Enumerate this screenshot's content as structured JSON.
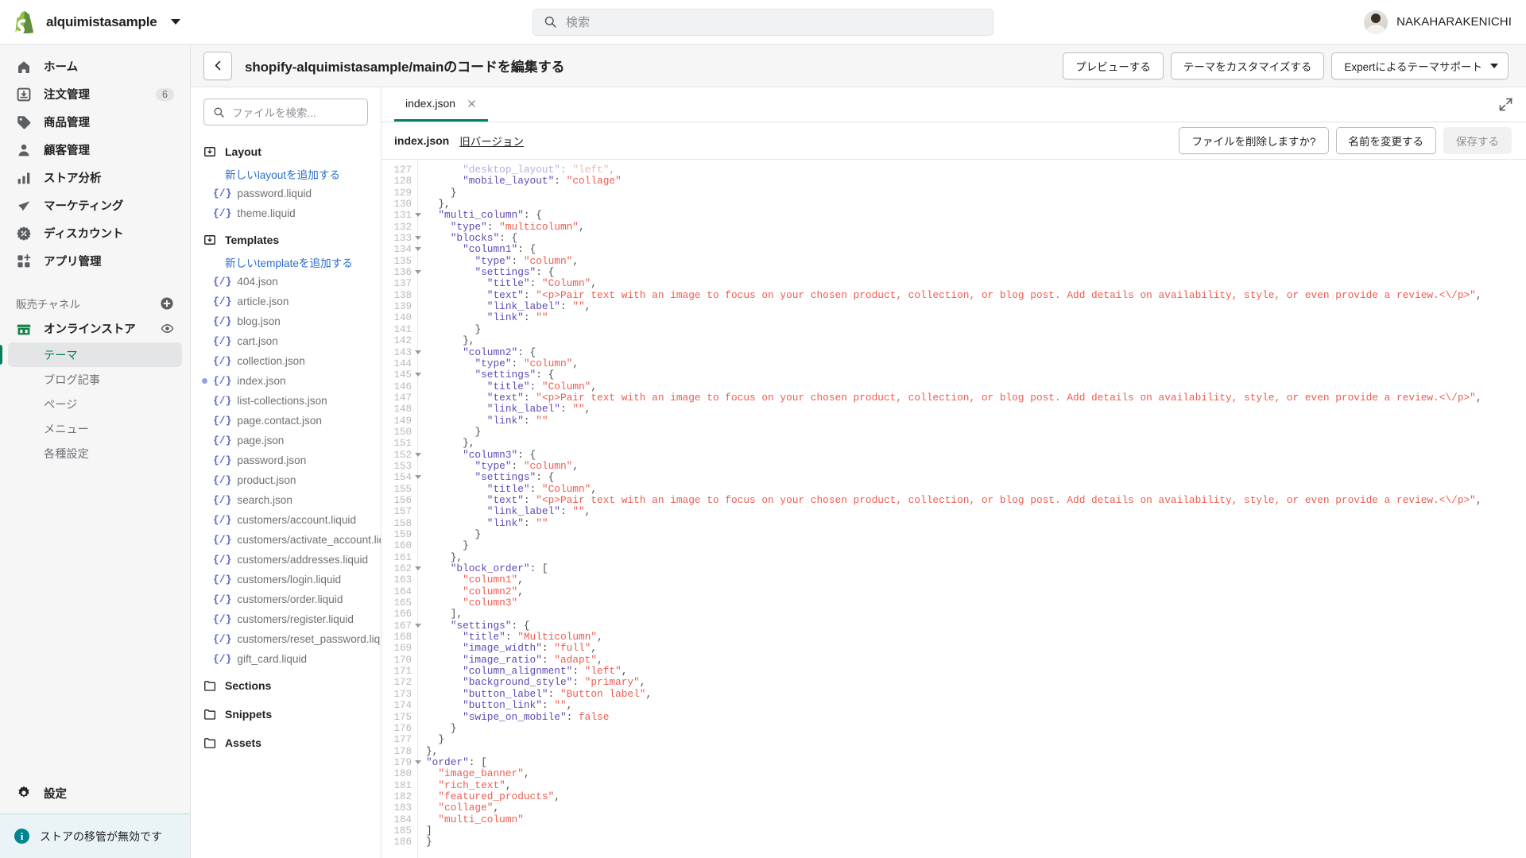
{
  "topbar": {
    "store_name": "alquimistasample",
    "store_caret_icon": "chevron-down-icon",
    "search_icon": "search-icon",
    "search_placeholder": "検索",
    "search_value": "",
    "user_name": "NAKAHARAKENICHI",
    "logo_icon": "shopify-bag-icon"
  },
  "sidebar": {
    "items": [
      {
        "label": "ホーム",
        "icon": "home-icon",
        "badge": ""
      },
      {
        "label": "注文管理",
        "icon": "orders-inbox-icon",
        "badge": "6"
      },
      {
        "label": "商品管理",
        "icon": "product-tag-icon",
        "badge": ""
      },
      {
        "label": "顧客管理",
        "icon": "customer-person-icon",
        "badge": ""
      },
      {
        "label": "ストア分析",
        "icon": "analytics-bars-icon",
        "badge": ""
      },
      {
        "label": "マーケティング",
        "icon": "marketing-megaphone-icon",
        "badge": ""
      },
      {
        "label": "ディスカウント",
        "icon": "discount-percent-icon",
        "badge": ""
      },
      {
        "label": "アプリ管理",
        "icon": "apps-grid-plus-icon",
        "badge": ""
      }
    ],
    "channels_header": "販売チャネル",
    "channels_add_icon": "plus-circle-icon",
    "online_store": {
      "label": "オンラインストア",
      "icon": "storefront-icon",
      "view_icon": "eye-icon"
    },
    "online_store_children": [
      {
        "label": "テーマ",
        "active": true
      },
      {
        "label": "ブログ記事",
        "active": false
      },
      {
        "label": "ページ",
        "active": false
      },
      {
        "label": "メニュー",
        "active": false
      },
      {
        "label": "各種設定",
        "active": false
      }
    ],
    "settings": {
      "label": "設定",
      "icon": "gear-icon"
    },
    "notice": {
      "icon": "info-icon",
      "text": "ストアの移管が無効です"
    }
  },
  "editor_header": {
    "back_icon": "arrow-left-icon",
    "title": "shopify-alquimistasample/mainのコードを編集する",
    "buttons": [
      {
        "label": "プレビューする",
        "name": "preview-button",
        "caret": false
      },
      {
        "label": "テーマをカスタマイズする",
        "name": "customize-theme-button",
        "caret": false
      },
      {
        "label": "Expertによるテーマサポート",
        "name": "expert-theme-support-button",
        "caret": true
      }
    ],
    "caret_icon": "chevron-down-icon"
  },
  "filetree": {
    "search_icon": "search-icon",
    "search_placeholder": "ファイルを検索...",
    "search_value": "",
    "groups": [
      {
        "name": "Layout",
        "icon": "folder-download-icon",
        "add_link": "新しいlayoutを追加する",
        "files": [
          {
            "name": "password.liquid",
            "modified": false
          },
          {
            "name": "theme.liquid",
            "modified": false
          }
        ]
      },
      {
        "name": "Templates",
        "icon": "folder-download-icon",
        "add_link": "新しいtemplateを追加する",
        "files": [
          {
            "name": "404.json",
            "modified": false
          },
          {
            "name": "article.json",
            "modified": false
          },
          {
            "name": "blog.json",
            "modified": false
          },
          {
            "name": "cart.json",
            "modified": false
          },
          {
            "name": "collection.json",
            "modified": false
          },
          {
            "name": "index.json",
            "modified": true
          },
          {
            "name": "list-collections.json",
            "modified": false
          },
          {
            "name": "page.contact.json",
            "modified": false
          },
          {
            "name": "page.json",
            "modified": false
          },
          {
            "name": "password.json",
            "modified": false
          },
          {
            "name": "product.json",
            "modified": false
          },
          {
            "name": "search.json",
            "modified": false
          },
          {
            "name": "customers/account.liquid",
            "modified": false
          },
          {
            "name": "customers/activate_account.liquid",
            "modified": false
          },
          {
            "name": "customers/addresses.liquid",
            "modified": false
          },
          {
            "name": "customers/login.liquid",
            "modified": false
          },
          {
            "name": "customers/order.liquid",
            "modified": false
          },
          {
            "name": "customers/register.liquid",
            "modified": false
          },
          {
            "name": "customers/reset_password.liquid",
            "modified": false
          },
          {
            "name": "gift_card.liquid",
            "modified": false
          }
        ]
      }
    ],
    "collapsed_folders": [
      {
        "name": "Sections",
        "icon": "folder-icon"
      },
      {
        "name": "Snippets",
        "icon": "folder-icon"
      },
      {
        "name": "Assets",
        "icon": "folder-icon"
      }
    ]
  },
  "codepane": {
    "tab": {
      "label": "index.json",
      "close_icon": "close-icon"
    },
    "expand_icon": "expand-fullscreen-icon",
    "file_name": "index.json",
    "old_version_link": "旧バージョン",
    "actions": [
      {
        "label": "ファイルを削除しますか?",
        "name": "delete-file-button",
        "disabled": false
      },
      {
        "label": "名前を変更する",
        "name": "rename-file-button",
        "disabled": false
      },
      {
        "label": "保存する",
        "name": "save-button",
        "disabled": true
      }
    ],
    "first_line": 127,
    "last_line": 186,
    "fold_lines": [
      131,
      133,
      134,
      136,
      143,
      145,
      152,
      154,
      162,
      167,
      179
    ],
    "lines": [
      {
        "n": 127,
        "html": "<span class=\"trunc-top\">      <span class=\"k\">\"desktop_layout\"</span><span class=\"p\">: </span><span class=\"s\">\"left\"</span><span class=\"p\">,</span></span>"
      },
      {
        "n": 128,
        "html": "      <span class=\"k\">\"mobile_layout\"</span><span class=\"p\">: </span><span class=\"s\">\"collage\"</span>"
      },
      {
        "n": 129,
        "html": "    <span class=\"p\">}</span>"
      },
      {
        "n": 130,
        "html": "  <span class=\"p\">},</span>"
      },
      {
        "n": 131,
        "html": "  <span class=\"k\">\"multi_column\"</span><span class=\"p\">: {</span>"
      },
      {
        "n": 132,
        "html": "    <span class=\"k\">\"type\"</span><span class=\"p\">: </span><span class=\"s\">\"multicolumn\"</span><span class=\"p\">,</span>"
      },
      {
        "n": 133,
        "html": "    <span class=\"k\">\"blocks\"</span><span class=\"p\">: {</span>"
      },
      {
        "n": 134,
        "html": "      <span class=\"k\">\"column1\"</span><span class=\"p\">: {</span>"
      },
      {
        "n": 135,
        "html": "        <span class=\"k\">\"type\"</span><span class=\"p\">: </span><span class=\"s\">\"column\"</span><span class=\"p\">,</span>"
      },
      {
        "n": 136,
        "html": "        <span class=\"k\">\"settings\"</span><span class=\"p\">: {</span>"
      },
      {
        "n": 137,
        "html": "          <span class=\"k\">\"title\"</span><span class=\"p\">: </span><span class=\"s\">\"Column\"</span><span class=\"p\">,</span>"
      },
      {
        "n": 138,
        "html": "          <span class=\"k\">\"text\"</span><span class=\"p\">: </span><span class=\"s\">\"&lt;p&gt;Pair text with an image to focus on your chosen product, collection, or blog post. Add details on availability, style, or even provide a review.&lt;\\/p&gt;\"</span><span class=\"p\">,</span>"
      },
      {
        "n": 139,
        "html": "          <span class=\"k\">\"link_label\"</span><span class=\"p\">: </span><span class=\"s\">\"\"</span><span class=\"p\">,</span>"
      },
      {
        "n": 140,
        "html": "          <span class=\"k\">\"link\"</span><span class=\"p\">: </span><span class=\"s\">\"\"</span>"
      },
      {
        "n": 141,
        "html": "        <span class=\"p\">}</span>"
      },
      {
        "n": 142,
        "html": "      <span class=\"p\">},</span>"
      },
      {
        "n": 143,
        "html": "      <span class=\"k\">\"column2\"</span><span class=\"p\">: {</span>"
      },
      {
        "n": 144,
        "html": "        <span class=\"k\">\"type\"</span><span class=\"p\">: </span><span class=\"s\">\"column\"</span><span class=\"p\">,</span>"
      },
      {
        "n": 145,
        "html": "        <span class=\"k\">\"settings\"</span><span class=\"p\">: {</span>"
      },
      {
        "n": 146,
        "html": "          <span class=\"k\">\"title\"</span><span class=\"p\">: </span><span class=\"s\">\"Column\"</span><span class=\"p\">,</span>"
      },
      {
        "n": 147,
        "html": "          <span class=\"k\">\"text\"</span><span class=\"p\">: </span><span class=\"s\">\"&lt;p&gt;Pair text with an image to focus on your chosen product, collection, or blog post. Add details on availability, style, or even provide a review.&lt;\\/p&gt;\"</span><span class=\"p\">,</span>"
      },
      {
        "n": 148,
        "html": "          <span class=\"k\">\"link_label\"</span><span class=\"p\">: </span><span class=\"s\">\"\"</span><span class=\"p\">,</span>"
      },
      {
        "n": 149,
        "html": "          <span class=\"k\">\"link\"</span><span class=\"p\">: </span><span class=\"s\">\"\"</span>"
      },
      {
        "n": 150,
        "html": "        <span class=\"p\">}</span>"
      },
      {
        "n": 151,
        "html": "      <span class=\"p\">},</span>"
      },
      {
        "n": 152,
        "html": "      <span class=\"k\">\"column3\"</span><span class=\"p\">: {</span>"
      },
      {
        "n": 153,
        "html": "        <span class=\"k\">\"type\"</span><span class=\"p\">: </span><span class=\"s\">\"column\"</span><span class=\"p\">,</span>"
      },
      {
        "n": 154,
        "html": "        <span class=\"k\">\"settings\"</span><span class=\"p\">: {</span>"
      },
      {
        "n": 155,
        "html": "          <span class=\"k\">\"title\"</span><span class=\"p\">: </span><span class=\"s\">\"Column\"</span><span class=\"p\">,</span>"
      },
      {
        "n": 156,
        "html": "          <span class=\"k\">\"text\"</span><span class=\"p\">: </span><span class=\"s\">\"&lt;p&gt;Pair text with an image to focus on your chosen product, collection, or blog post. Add details on availability, style, or even provide a review.&lt;\\/p&gt;\"</span><span class=\"p\">,</span>"
      },
      {
        "n": 157,
        "html": "          <span class=\"k\">\"link_label\"</span><span class=\"p\">: </span><span class=\"s\">\"\"</span><span class=\"p\">,</span>"
      },
      {
        "n": 158,
        "html": "          <span class=\"k\">\"link\"</span><span class=\"p\">: </span><span class=\"s\">\"\"</span>"
      },
      {
        "n": 159,
        "html": "        <span class=\"p\">}</span>"
      },
      {
        "n": 160,
        "html": "      <span class=\"p\">}</span>"
      },
      {
        "n": 161,
        "html": "    <span class=\"p\">},</span>"
      },
      {
        "n": 162,
        "html": "    <span class=\"k\">\"block_order\"</span><span class=\"p\">: [</span>"
      },
      {
        "n": 163,
        "html": "      <span class=\"s\">\"column1\"</span><span class=\"p\">,</span>"
      },
      {
        "n": 164,
        "html": "      <span class=\"s\">\"column2\"</span><span class=\"p\">,</span>"
      },
      {
        "n": 165,
        "html": "      <span class=\"s\">\"column3\"</span>"
      },
      {
        "n": 166,
        "html": "    <span class=\"p\">],</span>"
      },
      {
        "n": 167,
        "html": "    <span class=\"k\">\"settings\"</span><span class=\"p\">: {</span>"
      },
      {
        "n": 168,
        "html": "      <span class=\"k\">\"title\"</span><span class=\"p\">: </span><span class=\"s\">\"Multicolumn\"</span><span class=\"p\">,</span>"
      },
      {
        "n": 169,
        "html": "      <span class=\"k\">\"image_width\"</span><span class=\"p\">: </span><span class=\"s\">\"full\"</span><span class=\"p\">,</span>"
      },
      {
        "n": 170,
        "html": "      <span class=\"k\">\"image_ratio\"</span><span class=\"p\">: </span><span class=\"s\">\"adapt\"</span><span class=\"p\">,</span>"
      },
      {
        "n": 171,
        "html": "      <span class=\"k\">\"column_alignment\"</span><span class=\"p\">: </span><span class=\"s\">\"left\"</span><span class=\"p\">,</span>"
      },
      {
        "n": 172,
        "html": "      <span class=\"k\">\"background_style\"</span><span class=\"p\">: </span><span class=\"s\">\"primary\"</span><span class=\"p\">,</span>"
      },
      {
        "n": 173,
        "html": "      <span class=\"k\">\"button_label\"</span><span class=\"p\">: </span><span class=\"s\">\"Button label\"</span><span class=\"p\">,</span>"
      },
      {
        "n": 174,
        "html": "      <span class=\"k\">\"button_link\"</span><span class=\"p\">: </span><span class=\"s\">\"\"</span><span class=\"p\">,</span>"
      },
      {
        "n": 175,
        "html": "      <span class=\"k\">\"swipe_on_mobile\"</span><span class=\"p\">: </span><span class=\"b\">false</span>"
      },
      {
        "n": 176,
        "html": "    <span class=\"p\">}</span>"
      },
      {
        "n": 177,
        "html": "  <span class=\"p\">}</span>"
      },
      {
        "n": 178,
        "html": "<span class=\"p\">},</span>"
      },
      {
        "n": 179,
        "html": "<span class=\"k\">\"order\"</span><span class=\"p\">: [</span>"
      },
      {
        "n": 180,
        "html": "  <span class=\"s\">\"image_banner\"</span><span class=\"p\">,</span>"
      },
      {
        "n": 181,
        "html": "  <span class=\"s\">\"rich_text\"</span><span class=\"p\">,</span>"
      },
      {
        "n": 182,
        "html": "  <span class=\"s\">\"featured_products\"</span><span class=\"p\">,</span>"
      },
      {
        "n": 183,
        "html": "  <span class=\"s\">\"collage\"</span><span class=\"p\">,</span>"
      },
      {
        "n": 184,
        "html": "  <span class=\"s\">\"multi_column\"</span>"
      },
      {
        "n": 185,
        "html": "<span class=\"p\">]</span>"
      },
      {
        "n": 186,
        "html": "<span class=\"p\">}</span>"
      }
    ]
  },
  "colors": {
    "brand_green": "#008060",
    "accent_blue": "#2c6ecb",
    "string_red": "#ed5c51",
    "key_purple": "#5e4ab5",
    "nav_bg": "#f6f6f7",
    "notice_bg": "#eaf4f6"
  }
}
